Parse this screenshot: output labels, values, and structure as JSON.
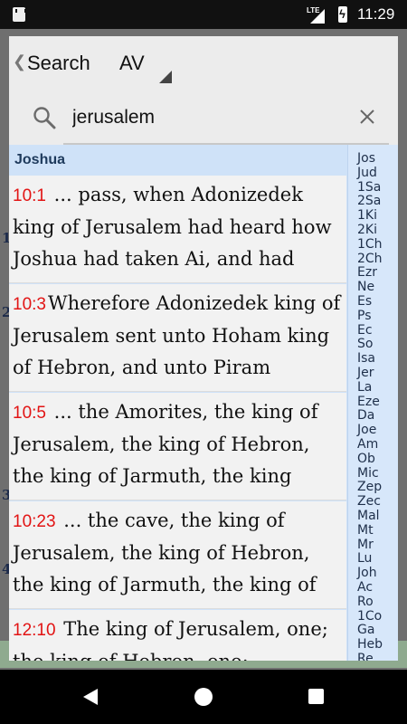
{
  "status_bar": {
    "time": "11:29",
    "network": "LTE"
  },
  "background": {
    "verse_numbers": [
      "1",
      "2",
      "3",
      "4"
    ]
  },
  "header": {
    "back_label": "Search",
    "version_label": "AV"
  },
  "search": {
    "value": "jerusalem"
  },
  "results": {
    "book_header": "Joshua",
    "items": [
      {
        "ref": "10:1",
        "text": "... pass, when Adonizedek king of Jerusalem had heard how Joshua had taken Ai, and had"
      },
      {
        "ref": "10:3",
        "text": "Wherefore Adonizedek king of Jerusalem sent unto Hoham king of Hebron, and unto Piram"
      },
      {
        "ref": "10:5",
        "text": "... the Amorites, the king of Jerusalem, the king of Hebron, the king of Jarmuth, the king"
      },
      {
        "ref": "10:23",
        "text": "... the cave, the king of Jerusalem, the king of Hebron, the king of Jarmuth, the king of"
      },
      {
        "ref": "12:10",
        "text": "The king of Jerusalem, one; the king of Hebron, one;"
      }
    ]
  },
  "book_index": [
    "Jos",
    "Jud",
    "1Sa",
    "2Sa",
    "1Ki",
    "2Ki",
    "1Ch",
    "2Ch",
    "Ezr",
    "Ne",
    "Es",
    "Ps",
    "Ec",
    "So",
    "Isa",
    "Jer",
    "La",
    "Eze",
    "Da",
    "Joe",
    "Am",
    "Ob",
    "Mic",
    "Zep",
    "Zec",
    "Mal",
    "Mt",
    "Mr",
    "Lu",
    "Joh",
    "Ac",
    "Ro",
    "1Co",
    "Ga",
    "Heb",
    "Re"
  ]
}
